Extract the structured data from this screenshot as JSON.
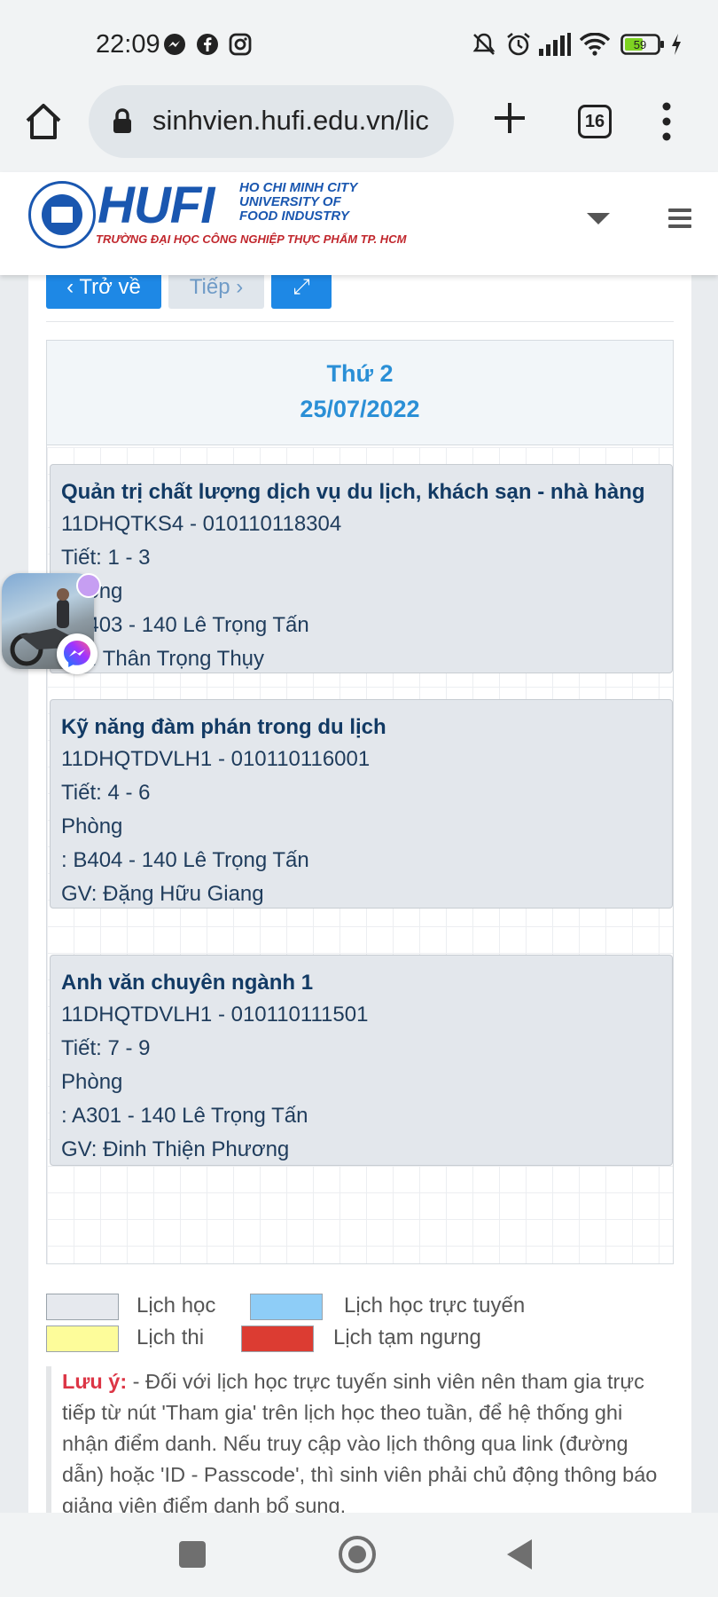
{
  "status_bar": {
    "time": "22:09",
    "battery": "59",
    "icons": [
      "messenger-icon",
      "facebook-icon",
      "instagram-icon",
      "mute-icon",
      "alarm-icon",
      "signal-icon",
      "wifi-icon",
      "battery-icon",
      "charging-icon"
    ]
  },
  "browser": {
    "url": "sinhvien.hufi.edu.vn/lic",
    "tab_count": "16"
  },
  "site_header": {
    "logo_main": "HUFI",
    "logo_en_line1": "HO CHI MINH CITY",
    "logo_en_line2": "UNIVERSITY OF",
    "logo_en_line3": "FOOD INDUSTRY",
    "logo_vn": "TRƯỜNG ĐẠI HỌC CÔNG NGHIỆP THỰC PHẨM TP. HCM"
  },
  "nav": {
    "back_label": "‹ Trở về",
    "next_label": "Tiếp ›",
    "expand_icon": "⤢"
  },
  "schedule": {
    "day_name": "Thứ 2",
    "date": "25/07/2022",
    "events": [
      {
        "title": "Quản trị chất lượng dịch vụ du lịch, khách sạn - nhà hàng",
        "code": "11DHQTKS4 - 010110118304",
        "period": "Tiết: 1 - 3",
        "room_label": "Phòng",
        "room": ": B403 - 140 Lê Trọng Tấn",
        "teacher": "GV: Thân Trọng Thụy"
      },
      {
        "title": "Kỹ năng đàm phán trong du lịch",
        "code": "11DHQTDVLH1 - 010110116001",
        "period": "Tiết: 4 - 6",
        "room_label": "Phòng",
        "room": ": B404 - 140 Lê Trọng Tấn",
        "teacher": "GV: Đặng Hữu Giang"
      },
      {
        "title": "Anh văn chuyên ngành 1",
        "code": "11DHQTDVLH1 - 010110111501",
        "period": "Tiết: 7 - 9",
        "room_label": "Phòng",
        "room": ": A301 - 140 Lê Trọng Tấn",
        "teacher": "GV: Đinh Thiện Phương"
      }
    ]
  },
  "legend": [
    {
      "label": "Lịch học",
      "color": "#e6e9ee"
    },
    {
      "label": "Lịch học trực tuyến",
      "color": "#8ecdf7"
    },
    {
      "label": "Lịch thi",
      "color": "#fdfc9a"
    },
    {
      "label": "Lịch tạm ngưng",
      "color": "#dc3c32"
    }
  ],
  "note": {
    "label": "Lưu ý:",
    "text": " - Đối với lịch học trực tuyến sinh viên nên tham gia trực tiếp từ nút 'Tham gia' trên lịch học theo tuần, để hệ thống ghi nhận điểm danh. Nếu truy cập vào lịch thông qua link (đường dẫn) hoặc 'ID - Passcode', thì sinh viên phải chủ động thông báo giảng viên điểm danh bổ sung."
  }
}
